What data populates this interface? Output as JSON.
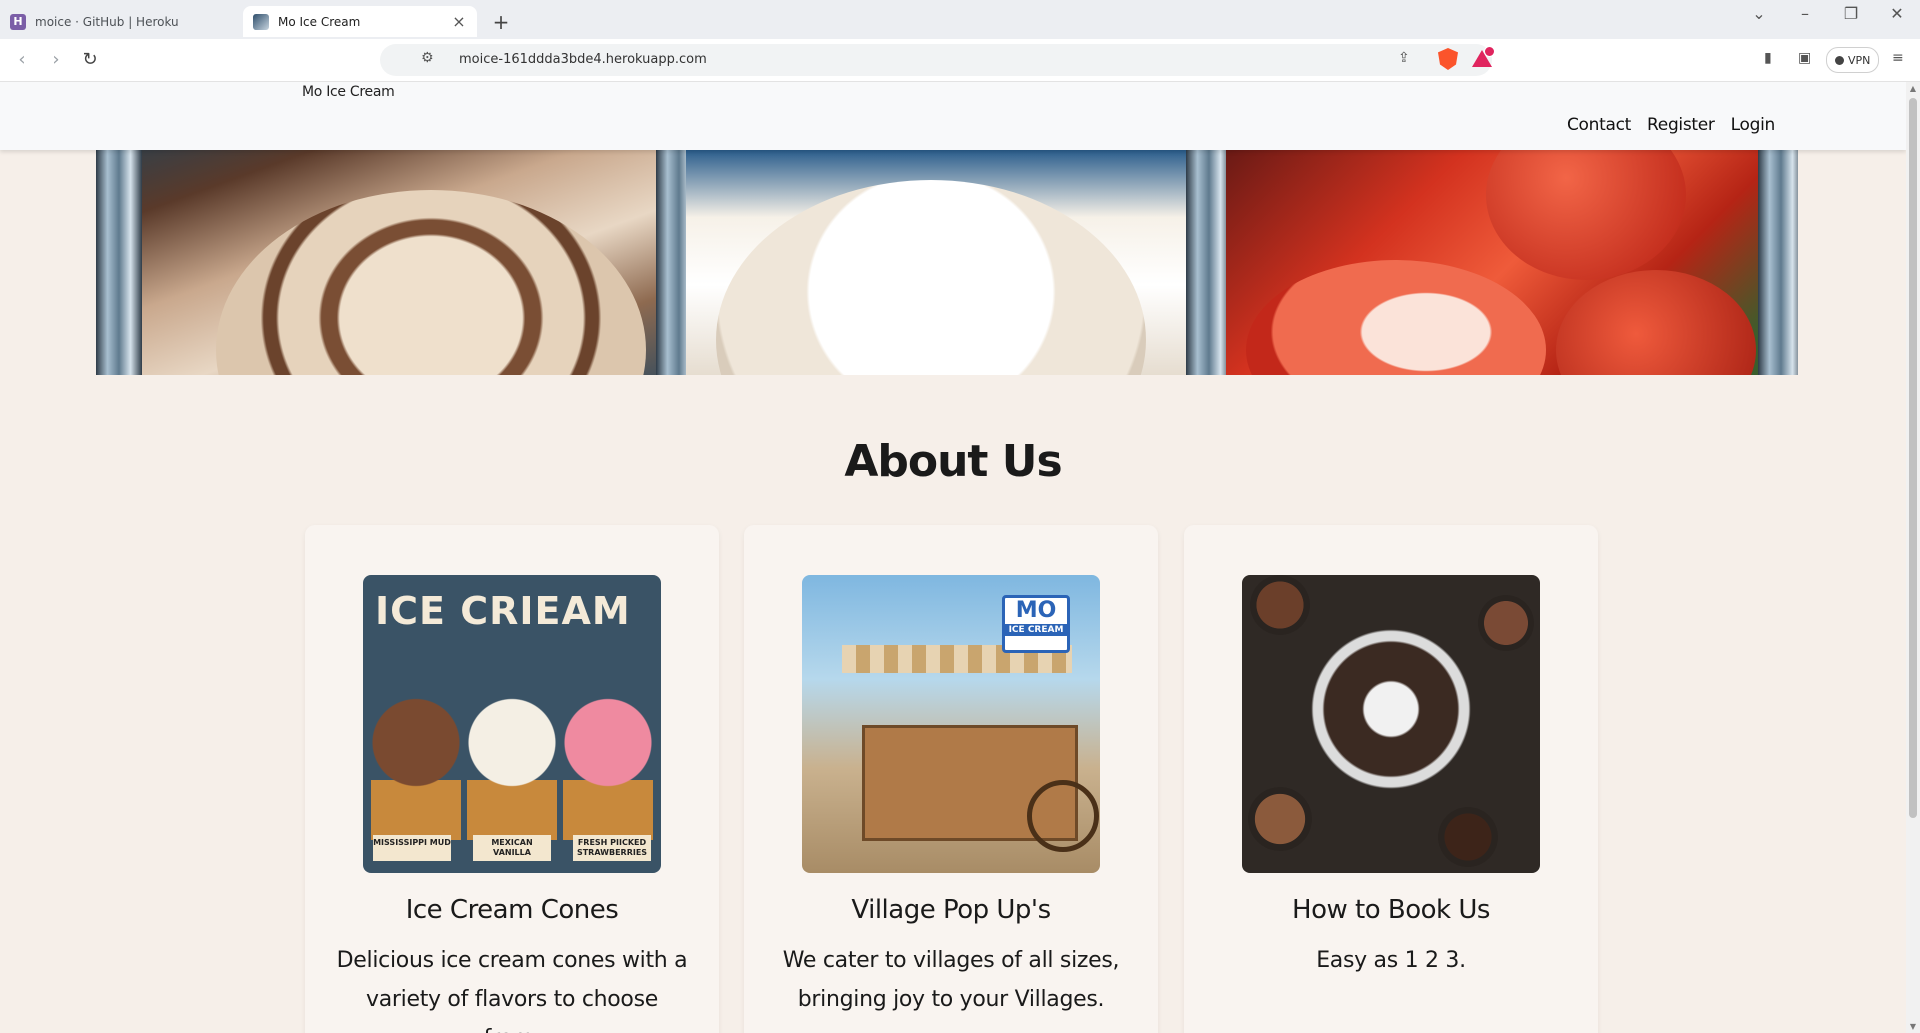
{
  "browser": {
    "tabs": [
      {
        "title": "moice · GitHub | Heroku",
        "active": false,
        "icon": "heroku-icon"
      },
      {
        "title": "Mo Ice Cream",
        "active": true,
        "icon": "site-favicon"
      }
    ],
    "url": "moice-161ddda3bde4.herokuapp.com",
    "vpn_label": "VPN"
  },
  "site": {
    "brand": "Mo Ice Cream",
    "nav": [
      {
        "label": "Contact"
      },
      {
        "label": "Register"
      },
      {
        "label": "Login"
      }
    ]
  },
  "about": {
    "title": "About Us",
    "cards": [
      {
        "title": "Ice Cream Cones",
        "text": "Delicious ice cream cones with a variety of flavors to choose from.",
        "image": {
          "heading": "ICE CRIEAM",
          "labels": [
            "MISSISSIPPI MUD",
            "MEXICAN VANILLA",
            "FRESH PIICKED STRAWBERRIES"
          ]
        }
      },
      {
        "title": "Village Pop Up's",
        "text": "We cater to villages of all sizes, bringing joy to your Villages.",
        "image": {
          "sign_big": "MO",
          "sign_small": "ICE CREAM"
        }
      },
      {
        "title": "How to Book Us",
        "text": "Easy as 1 2 3.",
        "image": {}
      }
    ]
  },
  "colors": {
    "page_bg": "#f6efe9",
    "card_bg": "#f9f4f0",
    "nav_bg": "#f8f9fa"
  }
}
